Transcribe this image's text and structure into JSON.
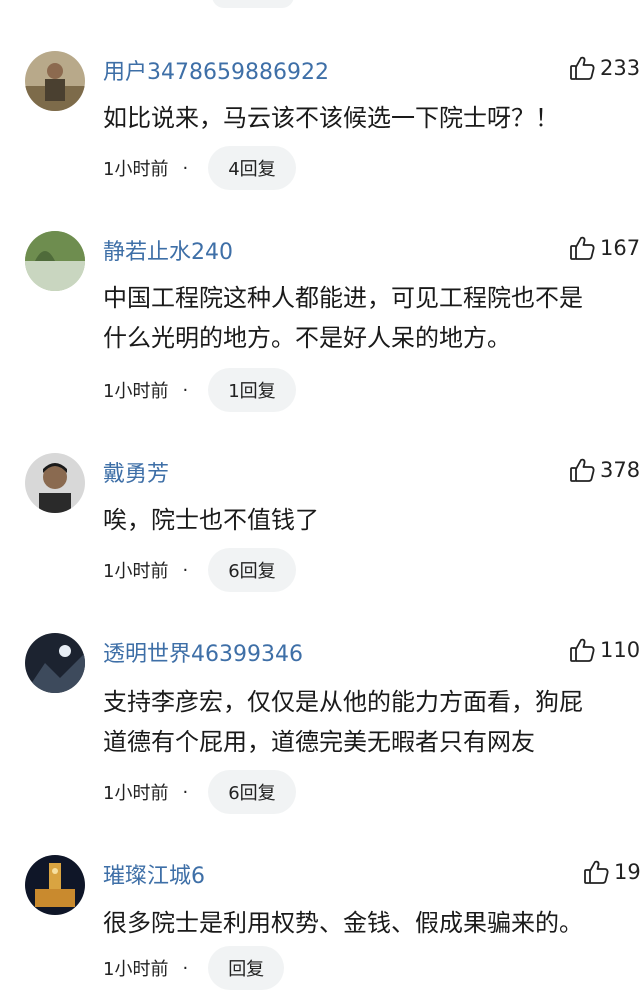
{
  "comments": [
    {
      "username": "用户3478659886922",
      "likes": "233",
      "lines": [
        "如比说来，马云该不该候选一下院士呀？！"
      ],
      "time": "1小时前",
      "dot": "·",
      "replies": "4回复",
      "avatar_color": "#8a7a5c"
    },
    {
      "username": "静若止水240",
      "likes": "167",
      "lines": [
        "中国工程院这种人都能进，可见工程院也不是",
        "什么光明的地方。不是好人呆的地方。"
      ],
      "time": "1小时前",
      "dot": "·",
      "replies": "1回复",
      "avatar_color": "#6f8a5e"
    },
    {
      "username": "戴勇芳",
      "likes": "378",
      "lines": [
        "唉，院士也不值钱了"
      ],
      "time": "1小时前",
      "dot": "·",
      "replies": "6回复",
      "avatar_color": "#3a3a3a"
    },
    {
      "username": "透明世界46399346",
      "likes": "110",
      "lines": [
        "支持李彦宏，仅仅是从他的能力方面看，狗屁",
        "道德有个屁用，道德完美无暇者只有网友"
      ],
      "time": "1小时前",
      "dot": "·",
      "replies": "6回复",
      "avatar_color": "#2c3440"
    },
    {
      "username": "璀璨江城6",
      "likes": "19",
      "lines": [
        "很多院士是利用权势、金钱、假成果骗来的。"
      ],
      "time": "1小时前",
      "dot": "·",
      "replies": "回复",
      "avatar_color": "#1e2a3a"
    }
  ]
}
